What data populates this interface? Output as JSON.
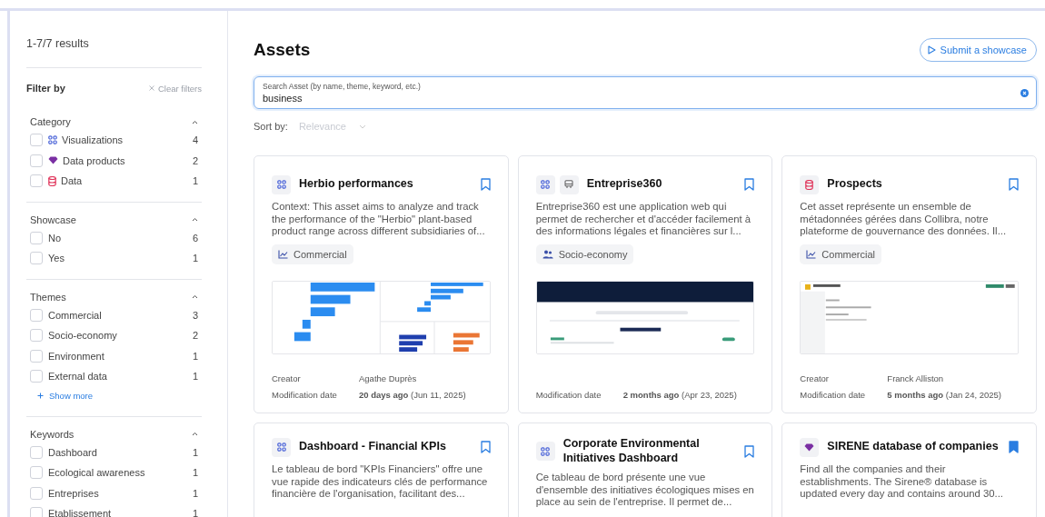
{
  "sidebar": {
    "results": "1-7/7 results",
    "filter_title": "Filter by",
    "clear_filters": "Clear filters",
    "sections": [
      {
        "title": "Category",
        "expanded": true,
        "options": [
          {
            "label": "Visualizations",
            "count": "4",
            "checked": false,
            "kind": "visualization"
          },
          {
            "label": "Data products",
            "count": "2",
            "checked": false,
            "kind": "product"
          },
          {
            "label": "Data",
            "count": "1",
            "checked": false,
            "kind": "data"
          }
        ]
      },
      {
        "title": "Showcase",
        "expanded": true,
        "options": [
          {
            "label": "No",
            "count": "6",
            "checked": false
          },
          {
            "label": "Yes",
            "count": "1",
            "checked": false
          }
        ]
      },
      {
        "title": "Themes",
        "expanded": true,
        "show_more": "Show more",
        "options": [
          {
            "label": "Commercial",
            "count": "3",
            "checked": false
          },
          {
            "label": "Socio-economy",
            "count": "2",
            "checked": false
          },
          {
            "label": "Environment",
            "count": "1",
            "checked": false
          },
          {
            "label": "External data",
            "count": "1",
            "checked": false
          }
        ]
      },
      {
        "title": "Keywords",
        "expanded": true,
        "options": [
          {
            "label": "Dashboard",
            "count": "1",
            "checked": false
          },
          {
            "label": "Ecological awareness",
            "count": "1",
            "checked": false
          },
          {
            "label": "Entreprises",
            "count": "1",
            "checked": false
          },
          {
            "label": "Etablissement",
            "count": "1",
            "checked": false
          }
        ]
      }
    ]
  },
  "main": {
    "title": "Assets",
    "submit_button": "Submit a showcase",
    "search": {
      "label": "Search Asset (by name, theme, keyword, etc.)",
      "value": "business"
    },
    "sort": {
      "label": "Sort by:",
      "value": "Relevance",
      "disabled": true
    },
    "cards": [
      {
        "title": "Herbio performances",
        "categories": [
          {
            "kind": "visualization"
          }
        ],
        "bookmarked": false,
        "description": "Context: This asset aims to analyze and track the performance of the \"Herbio\" plant-based product range across different subsidiaries of...",
        "theme": {
          "label": "Commercial",
          "kind": "chart"
        },
        "thumbnail": {
          "kind": "bars"
        },
        "creator_label": "Creator",
        "creator": "Agathe Duprès",
        "date_label": "Modification date",
        "date": "**20 days ago** (Jun 11, 2025)"
      },
      {
        "title": "Entreprise360",
        "categories": [
          {
            "kind": "visualization"
          },
          {
            "kind": "application"
          }
        ],
        "bookmarked": false,
        "description": "Entreprise360 est une application web qui permet de rechercher et d'accéder facilement à des informations légales et financières sur l...",
        "theme": {
          "label": "Socio-economy",
          "kind": "people"
        },
        "thumbnail": {
          "kind": "banner"
        },
        "date_label": "Modification date",
        "date": "**2 months ago** (Apr 23, 2025)"
      },
      {
        "title": "Prospects",
        "categories": [
          {
            "kind": "data"
          }
        ],
        "bookmarked": false,
        "description": "Cet asset représente un ensemble de métadonnées gérées dans Collibra, notre plateforme de gouvernance des données. Il...",
        "theme": {
          "label": "Commercial",
          "kind": "chart"
        },
        "thumbnail": {
          "kind": "app"
        },
        "creator_label": "Creator",
        "creator": "Franck Alliston",
        "date_label": "Modification date",
        "date": "**5 months ago** (Jan 24, 2025)"
      },
      {
        "title": "Dashboard - Financial KPIs",
        "categories": [
          {
            "kind": "visualization"
          }
        ],
        "bookmarked": false,
        "description": "Le tableau de bord \"KPIs Financiers\" offre une vue rapide des indicateurs clés de performance financière de l'organisation, facilitant des..."
      },
      {
        "title": "Corporate Environmental Initiatives Dashboard",
        "categories": [
          {
            "kind": "visualization"
          }
        ],
        "bookmarked": false,
        "description": "Ce tableau de bord présente une vue d'ensemble des initiatives écologiques mises en place au sein de l'entreprise. Il permet de..."
      },
      {
        "title": "SIRENE database of companies",
        "categories": [
          {
            "kind": "product"
          }
        ],
        "bookmarked": true,
        "description": "Find all the companies and their establishments. The Sirene® database is updated every day and contains around 30..."
      }
    ]
  }
}
